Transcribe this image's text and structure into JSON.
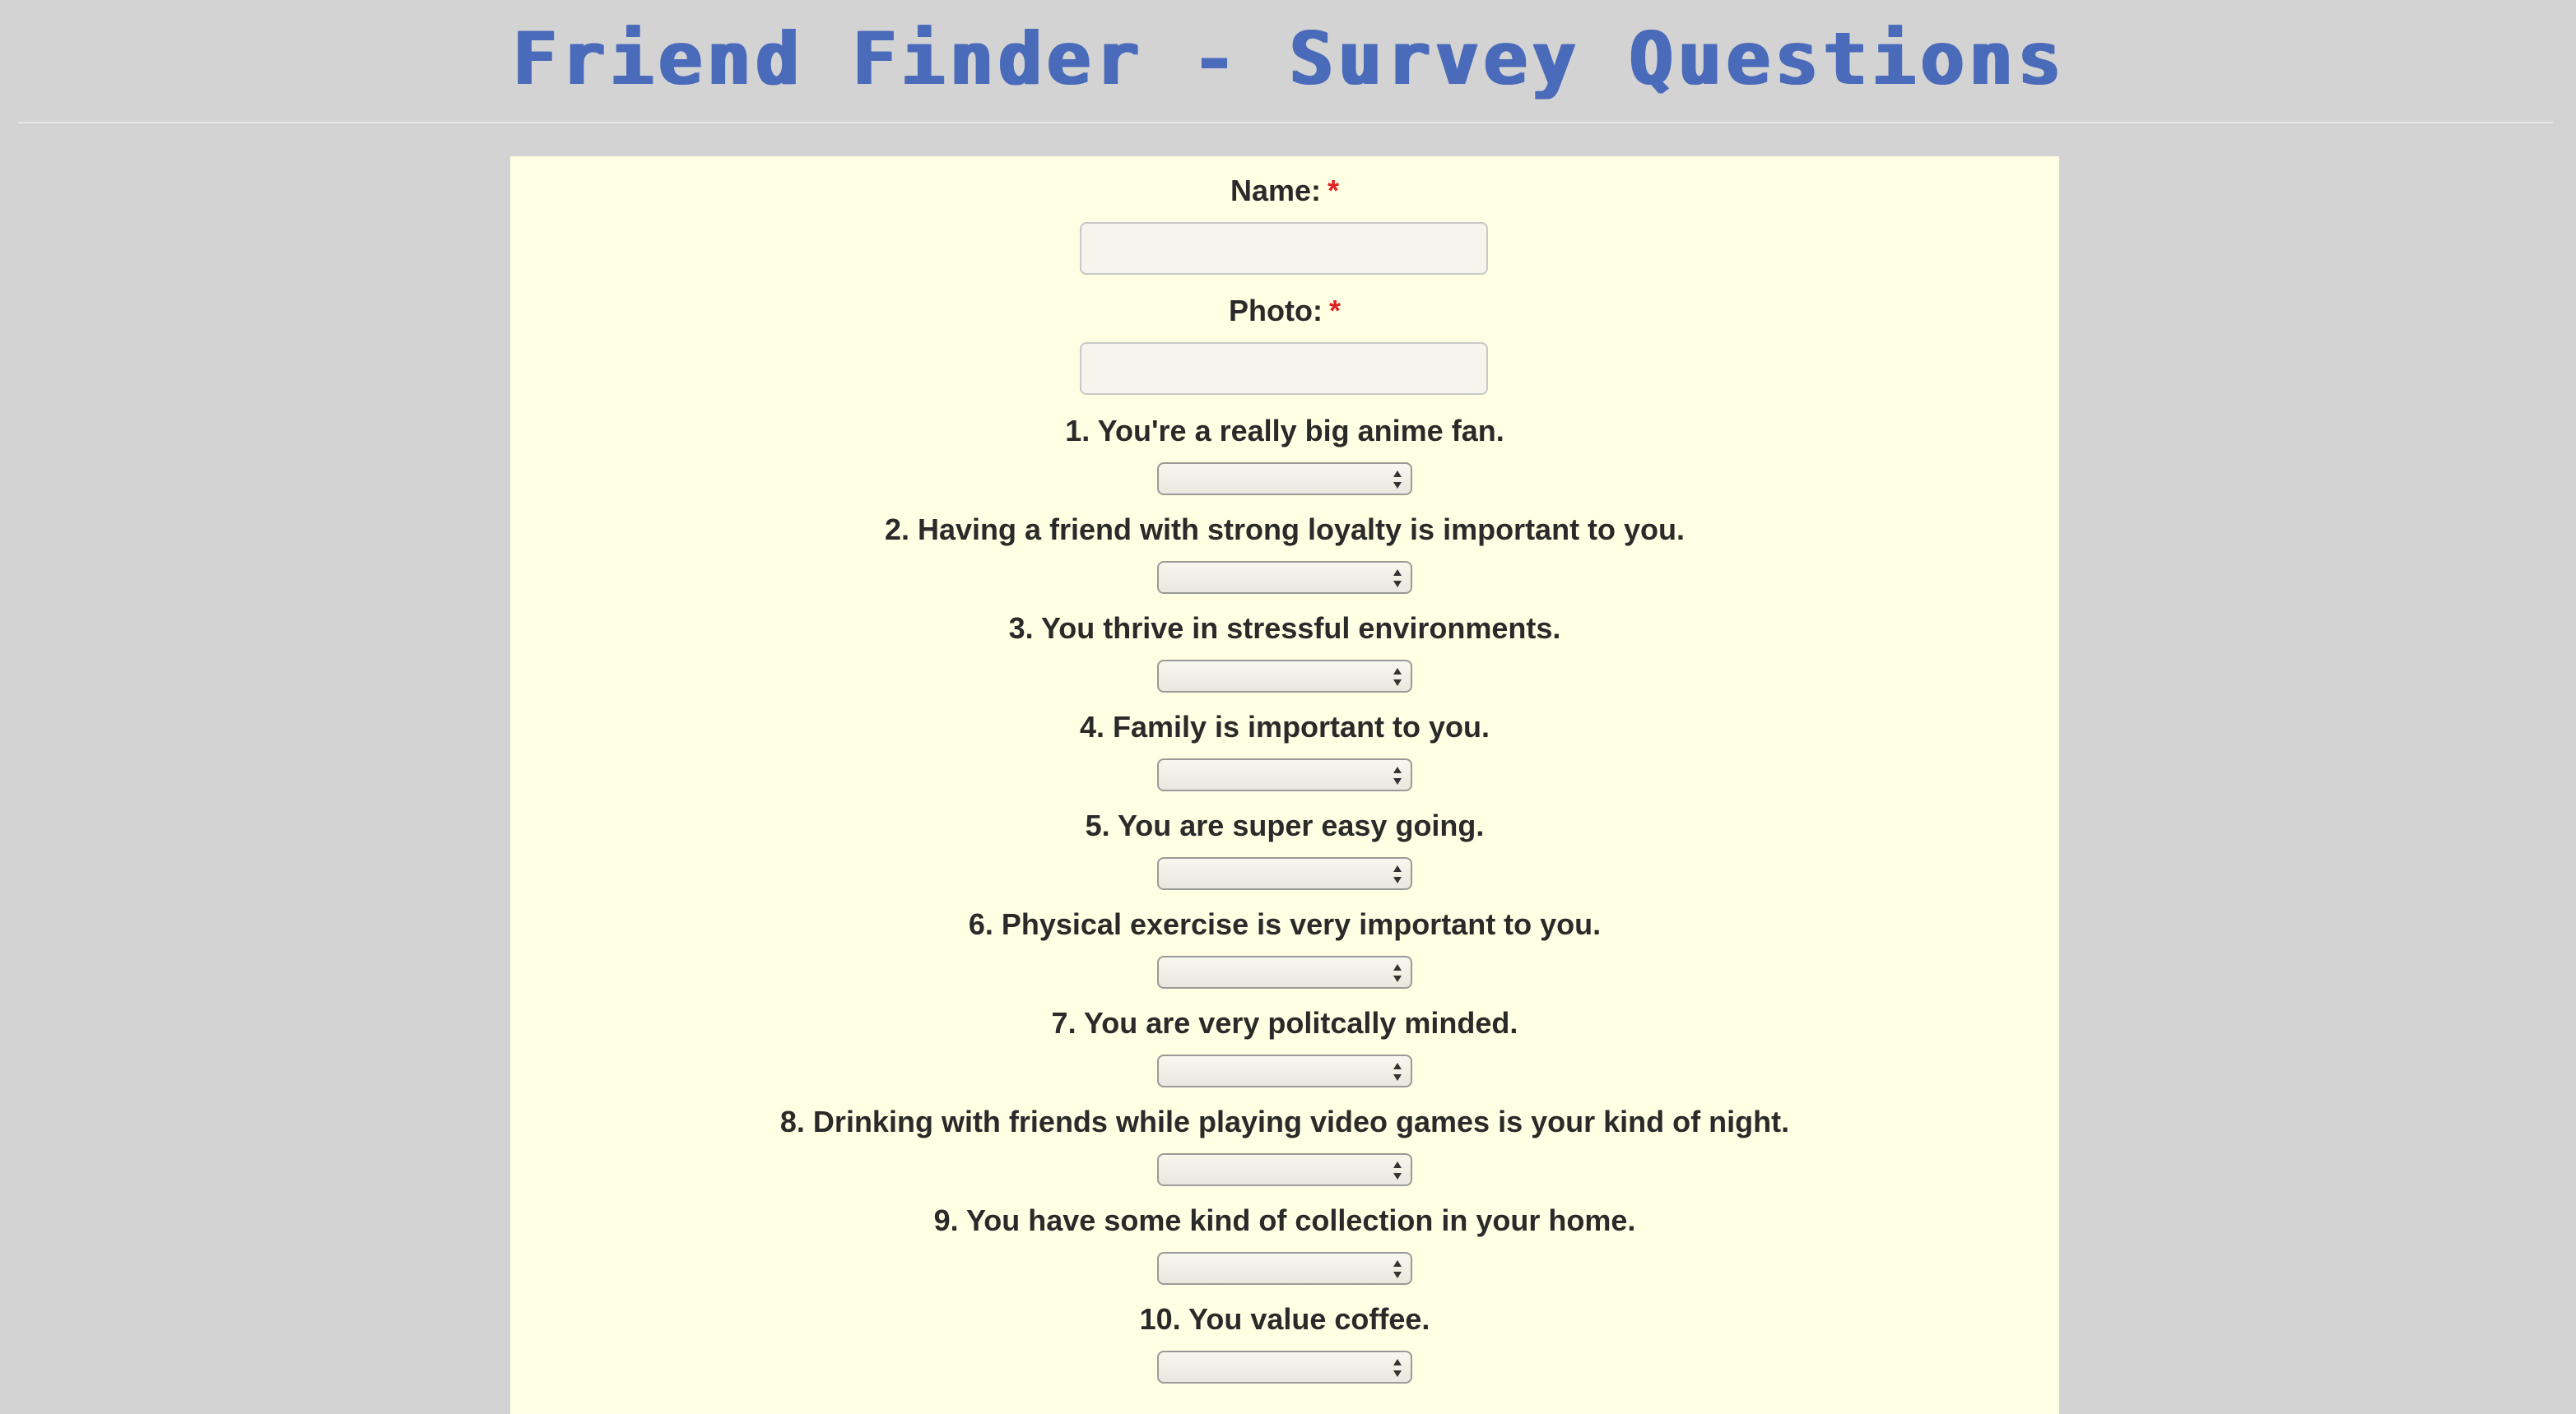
{
  "header": {
    "title": "Friend Finder - Survey Questions"
  },
  "form": {
    "name_label": "Name:",
    "photo_label": "Photo:",
    "required_marker": "*",
    "name_value": "",
    "photo_value": ""
  },
  "questions": [
    {
      "label": "1. You're a really big anime fan.",
      "selected": ""
    },
    {
      "label": "2. Having a friend with strong loyalty is important to you.",
      "selected": ""
    },
    {
      "label": "3. You thrive in stressful environments.",
      "selected": ""
    },
    {
      "label": "4. Family is important to you.",
      "selected": ""
    },
    {
      "label": "5. You are super easy going.",
      "selected": ""
    },
    {
      "label": "6. Physical exercise is very important to you.",
      "selected": ""
    },
    {
      "label": "7. You are very politcally minded.",
      "selected": ""
    },
    {
      "label": "8. Drinking with friends while playing video games is your kind of night.",
      "selected": ""
    },
    {
      "label": "9. You have some kind of collection in your home.",
      "selected": ""
    },
    {
      "label": "10. You value coffee.",
      "selected": ""
    }
  ],
  "icons": {
    "select_arrow": "up-down-chevron-icon"
  },
  "colors": {
    "page_background": "#d3d3d3",
    "title": "#4a6aba",
    "panel_background": "#ffffe3",
    "required_star": "#e02020",
    "label_text": "#2a2a2a"
  }
}
